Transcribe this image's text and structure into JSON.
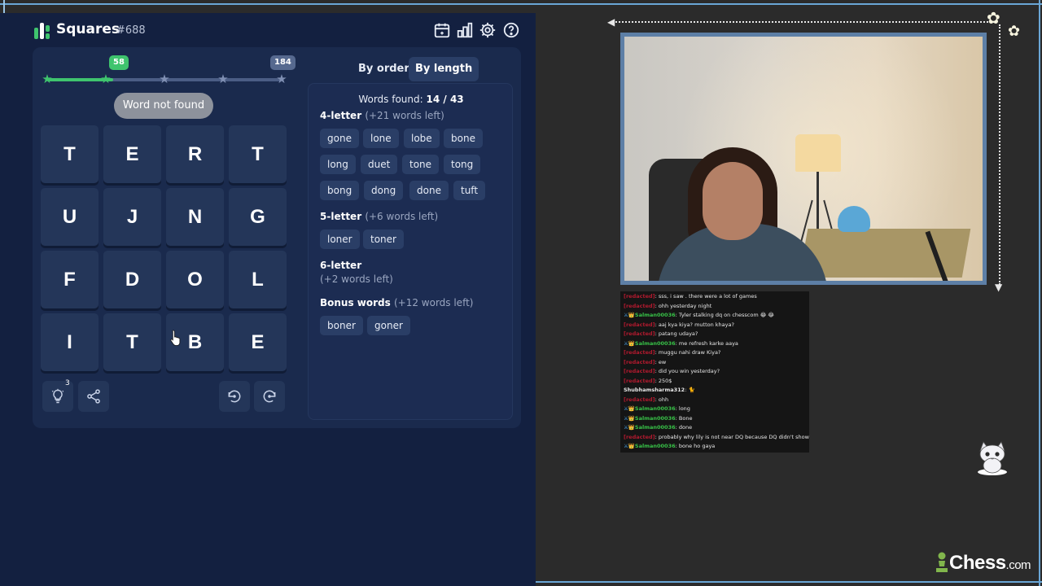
{
  "game": {
    "title": "Squares",
    "puzzle_number": "#688",
    "progress": {
      "current_score": "58",
      "max_score": "184",
      "current_value": 58,
      "max_value": 184
    },
    "toast": "Word not found",
    "grid": [
      [
        "T",
        "E",
        "R",
        "T"
      ],
      [
        "U",
        "J",
        "N",
        "G"
      ],
      [
        "F",
        "D",
        "O",
        "L"
      ],
      [
        "I",
        "T",
        "B",
        "E"
      ]
    ],
    "hint_count": "3",
    "icons": [
      "calendar-icon",
      "stats-icon",
      "settings-icon",
      "help-icon",
      "lightbulb-icon",
      "share-icon",
      "rotate-left-icon",
      "rotate-right-icon"
    ],
    "colors": {
      "background": "#132040",
      "accent": "#3fc46e",
      "tile": "#243659"
    }
  },
  "words": {
    "tabs": [
      {
        "label": "By order",
        "active": false
      },
      {
        "label": "By length",
        "active": true
      }
    ],
    "found_label": "Words found:",
    "found_value": "14 / 43",
    "sections": [
      {
        "title": "4-letter",
        "remaining": "(+21 words left)",
        "words": [
          "gone",
          "lone",
          "lobe",
          "bone",
          "long",
          "duet",
          "tone",
          "tong",
          "bong",
          "dong",
          "done",
          "tuft"
        ]
      },
      {
        "title": "5-letter",
        "remaining": "(+6 words left)",
        "words": [
          "loner",
          "toner"
        ]
      },
      {
        "title": "6-letter",
        "remaining": "(+2 words left)",
        "words": []
      },
      {
        "title": "Bonus words",
        "remaining": "(+12 words left)",
        "words": [
          "boner",
          "goner"
        ]
      }
    ]
  },
  "chat": [
    {
      "user": "[redacted]",
      "user_color": "red",
      "badge": false,
      "message": "sss, i saw . there were a lot of games"
    },
    {
      "user": "[redacted]",
      "user_color": "red",
      "badge": false,
      "message": "ohh yesterday night"
    },
    {
      "user": "Salman00036",
      "user_color": "green",
      "badge": true,
      "message": "Tyler stalking dq on chesscom 😂 😂"
    },
    {
      "user": "[redacted]",
      "user_color": "red",
      "badge": false,
      "message": "aaj kya kiya? mutton khaya?"
    },
    {
      "user": "[redacted]",
      "user_color": "red",
      "badge": false,
      "message": "patang udaya?"
    },
    {
      "user": "Salman00036",
      "user_color": "green",
      "badge": true,
      "message": "me refresh karke aaya"
    },
    {
      "user": "[redacted]",
      "user_color": "red",
      "badge": false,
      "message": "muggu nahi draw Kiya?"
    },
    {
      "user": "[redacted]",
      "user_color": "red",
      "badge": false,
      "message": "ew"
    },
    {
      "user": "[redacted]",
      "user_color": "red",
      "badge": false,
      "message": "did you win yesterday?"
    },
    {
      "user": "[redacted]",
      "user_color": "red",
      "badge": false,
      "message": "250$"
    },
    {
      "user": "Shubhamsharma312",
      "user_color": "white",
      "badge": false,
      "message": "🐈"
    },
    {
      "user": "[redacted]",
      "user_color": "red",
      "badge": false,
      "message": "ohh"
    },
    {
      "user": "Salman00036",
      "user_color": "green",
      "badge": true,
      "message": "long"
    },
    {
      "user": "Salman00036",
      "user_color": "green",
      "badge": true,
      "message": "Bone"
    },
    {
      "user": "Salman00036",
      "user_color": "green",
      "badge": true,
      "message": "done"
    },
    {
      "user": "[redacted]",
      "user_color": "red",
      "badge": false,
      "message": "probably why lily is not near DQ because DQ didn't shower 🚿"
    },
    {
      "user": "Salman00036",
      "user_color": "green",
      "badge": true,
      "message": "bone ho gaya"
    }
  ],
  "branding": {
    "name": "Chess",
    "suffix": ".com"
  }
}
